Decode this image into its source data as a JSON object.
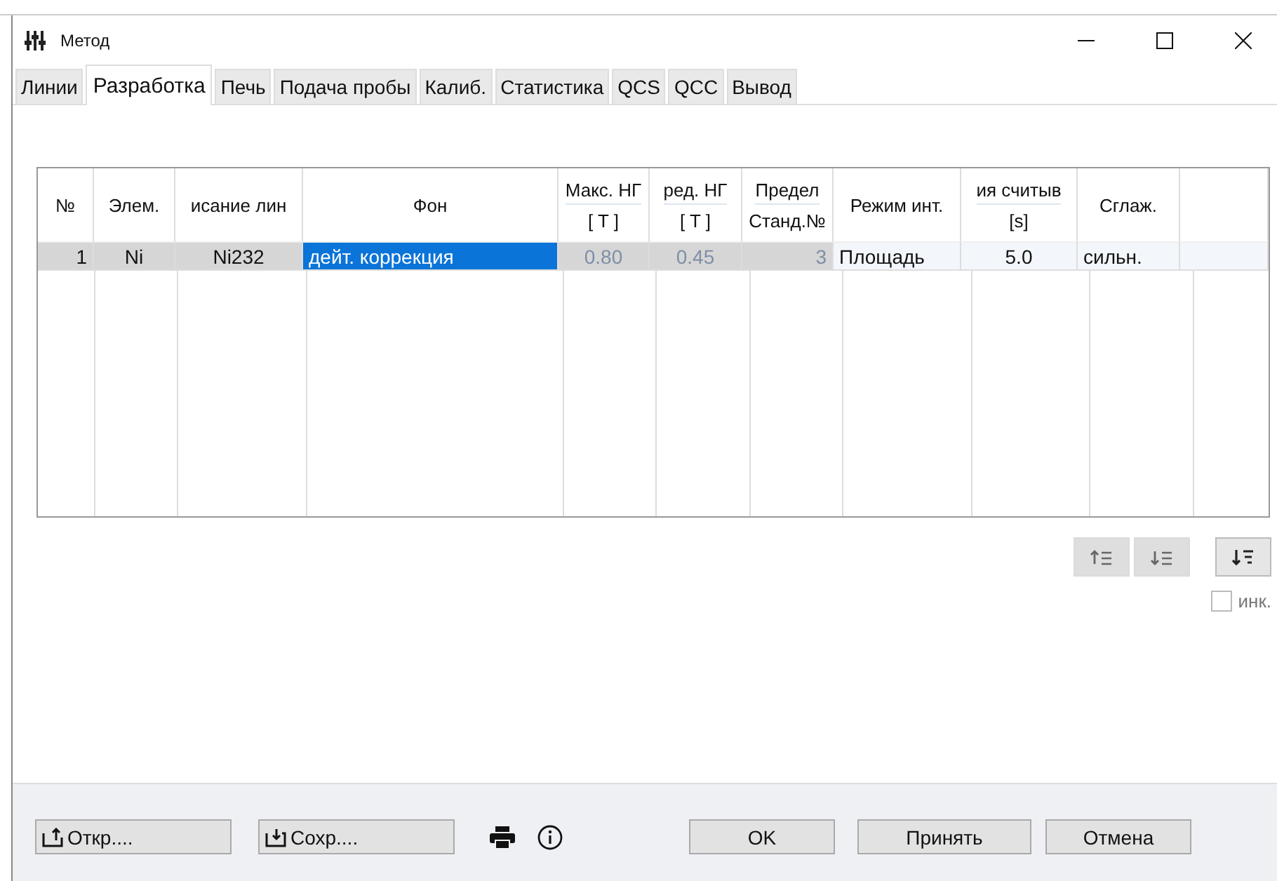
{
  "window": {
    "title": "Метод"
  },
  "tabs": [
    {
      "label": "Линии",
      "selected": false
    },
    {
      "label": "Разработка",
      "selected": true
    },
    {
      "label": "Печь",
      "selected": false
    },
    {
      "label": "Подача пробы",
      "selected": false
    },
    {
      "label": "Калиб.",
      "selected": false
    },
    {
      "label": "Статистика",
      "selected": false
    },
    {
      "label": "QCS",
      "selected": false
    },
    {
      "label": "QCC",
      "selected": false
    },
    {
      "label": "Вывод",
      "selected": false
    }
  ],
  "table": {
    "columns": [
      {
        "label": "№"
      },
      {
        "label": "Элем."
      },
      {
        "label": "исание лин"
      },
      {
        "label": "Фон"
      },
      {
        "label": "Макс. НГ",
        "unit": "[ T ]"
      },
      {
        "label": "ред. НГ",
        "unit": "[ T ]"
      },
      {
        "label": "Предел",
        "unit": "Станд.№"
      },
      {
        "label": "Режим инт."
      },
      {
        "label": "ия считыв",
        "unit": "[s]"
      },
      {
        "label": "Сглаж."
      }
    ],
    "rows": [
      {
        "cells": [
          {
            "text": "1",
            "kind": "fixed"
          },
          {
            "text": "Ni",
            "kind": "fixed"
          },
          {
            "text": "Ni232",
            "kind": "fixed"
          },
          {
            "text": "дейт. коррекция",
            "kind": "selected"
          },
          {
            "text": "0.80",
            "kind": "disabled"
          },
          {
            "text": "0.45",
            "kind": "disabled"
          },
          {
            "text": "3",
            "kind": "disabled"
          },
          {
            "text": "Площадь",
            "kind": "normal"
          },
          {
            "text": "5.0",
            "kind": "normal"
          },
          {
            "text": "сильн.",
            "kind": "normal"
          }
        ]
      }
    ]
  },
  "row_buttons": [
    {
      "disabled": true
    },
    {
      "disabled": true
    },
    {
      "disabled": false
    }
  ],
  "increment": {
    "label": "инк.",
    "checked": false,
    "disabled": true
  },
  "footer": {
    "open": "Откр....",
    "save": "Сохр....",
    "ok": "OK",
    "apply": "Принять",
    "cancel": "Отмена"
  }
}
